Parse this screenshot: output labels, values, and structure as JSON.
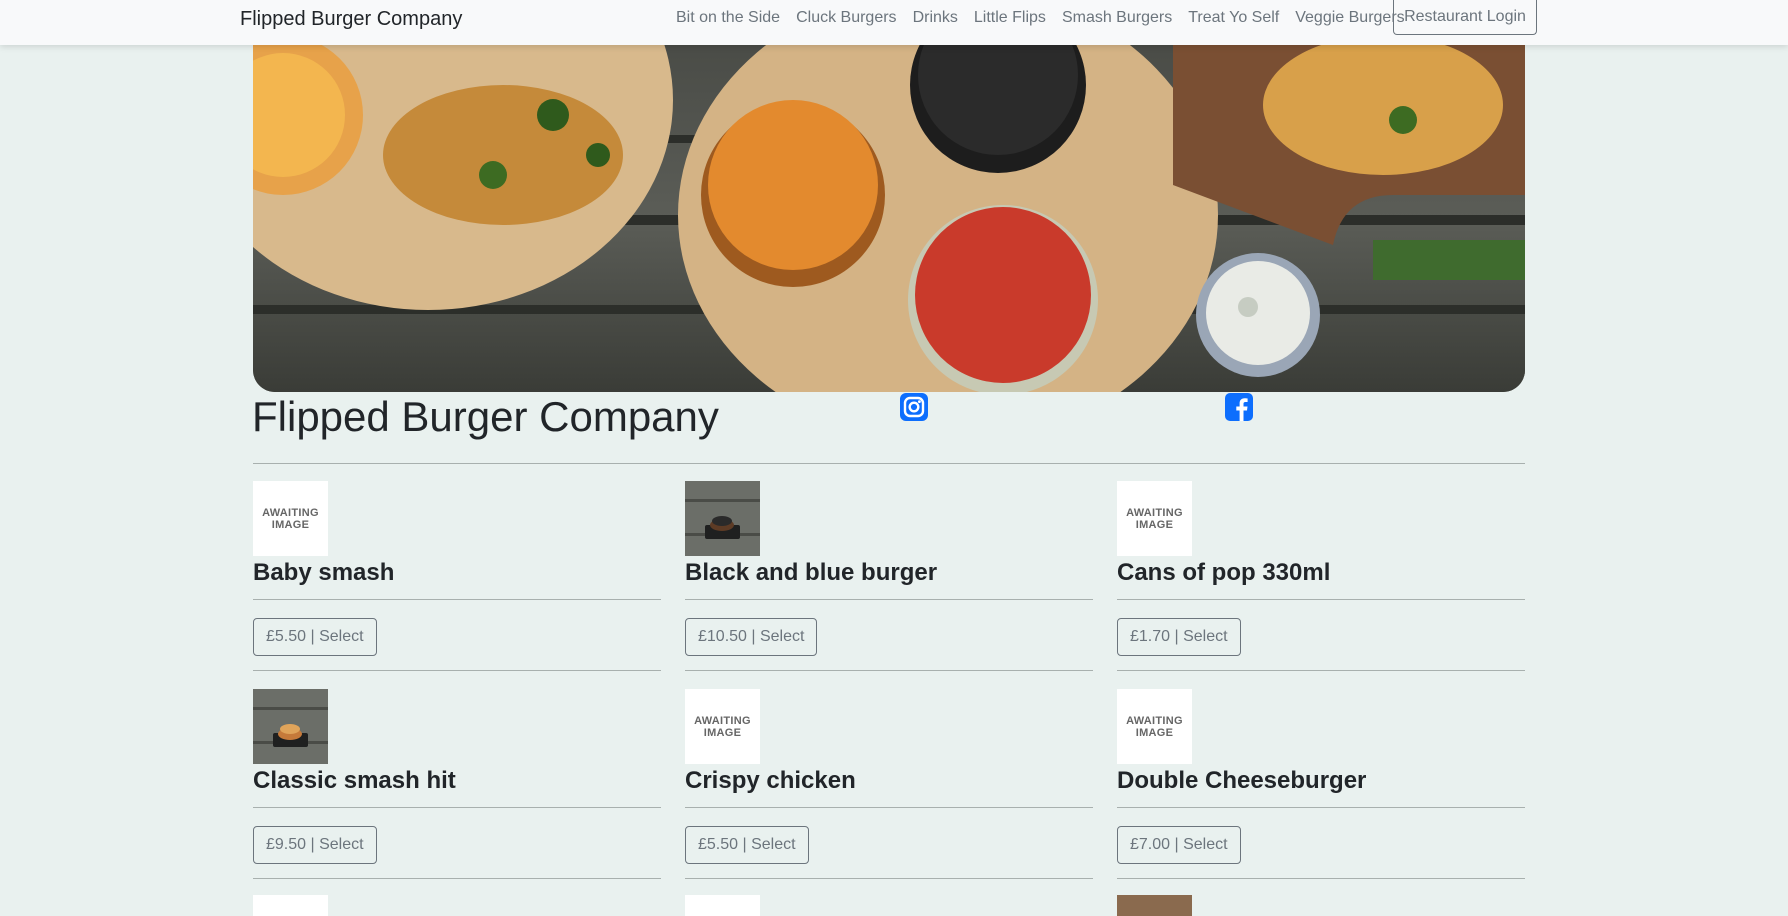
{
  "navbar": {
    "brand": "Flipped Burger Company",
    "links": [
      "Bit on the Side",
      "Cluck Burgers",
      "Drinks",
      "Little Flips",
      "Smash Burgers",
      "Treat Yo Self",
      "Veggie Burgers"
    ],
    "login_label": "Restaurant Login"
  },
  "page": {
    "title": "Flipped Burger Company",
    "social": {
      "instagram": "instagram-icon",
      "facebook": "facebook-icon"
    }
  },
  "awaiting_text": [
    "AWAITING",
    "IMAGE"
  ],
  "menu": {
    "items": [
      {
        "name": "Baby smash",
        "price_label": "£5.50 | Select",
        "image": "awaiting"
      },
      {
        "name": "Black and blue burger",
        "price_label": "£10.50 | Select",
        "image": "photo"
      },
      {
        "name": "Cans of pop 330ml",
        "price_label": "£1.70 | Select",
        "image": "awaiting"
      },
      {
        "name": "Classic smash hit",
        "price_label": "£9.50 | Select",
        "image": "photo"
      },
      {
        "name": "Crispy chicken",
        "price_label": "£5.50 | Select",
        "image": "awaiting"
      },
      {
        "name": "Double Cheeseburger",
        "price_label": "£7.00 | Select",
        "image": "awaiting"
      }
    ]
  },
  "colors": {
    "background": "#e9f1ef",
    "navbar": "#f8f9fa",
    "muted": "#6c757d",
    "social_blue": "#0d6efd"
  }
}
